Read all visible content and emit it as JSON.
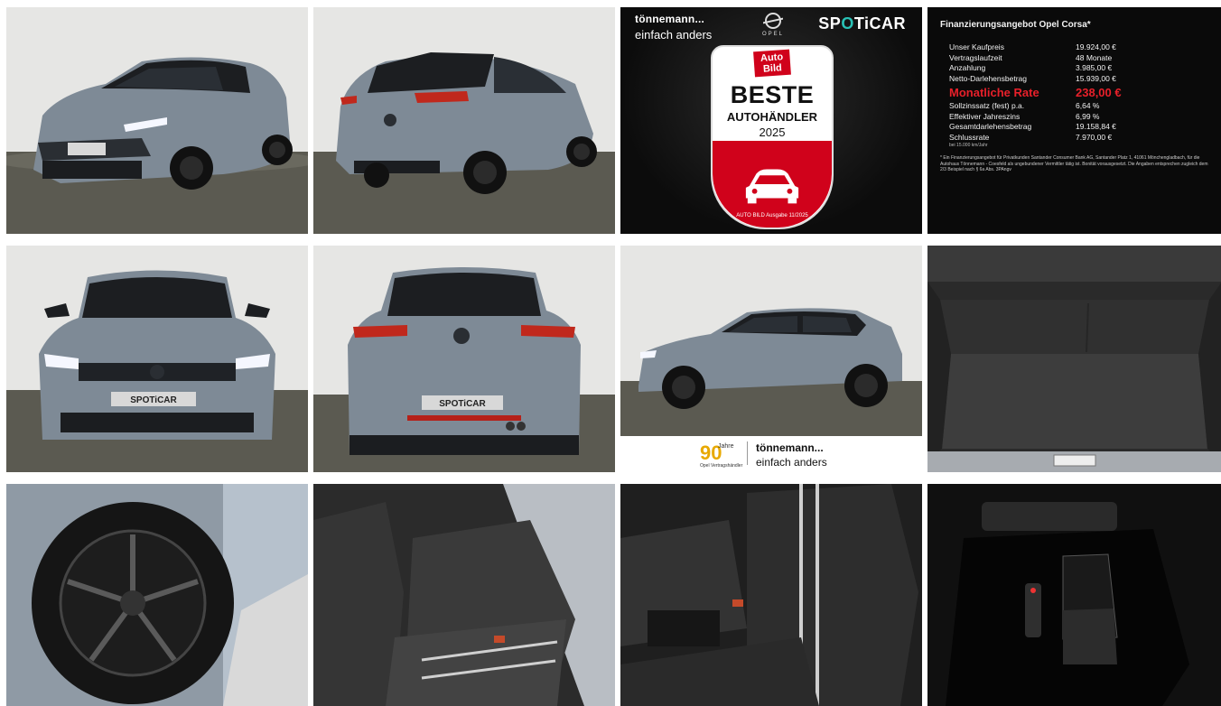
{
  "gallery": {
    "photos": [
      {
        "icon": "car-front-three-quarter-photo"
      },
      {
        "icon": "car-rear-three-quarter-photo"
      },
      {
        "icon": "dealer-award-banner"
      },
      {
        "icon": "financing-offer-panel"
      },
      {
        "icon": "car-front-photo"
      },
      {
        "icon": "car-rear-photo"
      },
      {
        "icon": "car-side-photo"
      },
      {
        "icon": "trunk-photo"
      },
      {
        "icon": "wheel-photo"
      },
      {
        "icon": "rear-seats-photo"
      },
      {
        "icon": "front-seat-photo"
      },
      {
        "icon": "center-console-photo"
      }
    ]
  },
  "dealer_banner": {
    "brand_line1": "tönnemann...",
    "brand_line2": "einfach anders",
    "opel_text": "OPEL",
    "spoticar_a": "SP",
    "spoticar_b": "O",
    "spoticar_c": "TiCAR",
    "badge_logo_line1": "Auto",
    "badge_logo_line2": "Bild",
    "badge_title": "BESTE",
    "badge_subtitle": "AUTOHÄNDLER",
    "badge_year": "2025",
    "badge_footer": "AUTO BILD Ausgabe 11/2025"
  },
  "finance": {
    "title": "Finanzierungsangebot Opel Corsa*",
    "rows": [
      {
        "label": "Unser Kaufpreis",
        "value": "19.924,00 €"
      },
      {
        "label": "Vertragslaufzeit",
        "value": "48 Monate"
      },
      {
        "label": "Anzahlung",
        "value": "3.985,00 €"
      },
      {
        "label": "Netto-Darlehensbetrag",
        "value": "15.939,00 €"
      }
    ],
    "rate_label": "Monatliche Rate",
    "rate_value": "238,00 €",
    "rows2": [
      {
        "label": "Sollzinssatz (fest) p.a.",
        "value": "6,64 %"
      },
      {
        "label": "Effektiver Jahreszins",
        "value": "6,99 %"
      },
      {
        "label": "Gesamtdarlehensbetrag",
        "value": "19.158,84 €"
      },
      {
        "label": "Schlussrate",
        "value": "7.970,00 €"
      }
    ],
    "mileage_note": "bei 15.000 km/Jahr",
    "footnote": "* Ein Finanzierungsangebot für Privatkunden Santander Consumer Bank AG, Santander Platz 1, 41061 Mönchengladbach, für die Autohaus Tönnemann - Coesfeld als ungebundener Vermittler tätig ist. Bonität vorausgesetzt. Die Angaben entsprechen zugleich dem 2/3 Beispiel nach § 6a Abs. 3PAngv"
  },
  "side_strip": {
    "ninety": "90",
    "jahre": "Jahre",
    "opel_partner": "Opel Vertragshändler",
    "brand_line1": "tönnemann...",
    "brand_line2": "einfach anders"
  },
  "plate_text": "SPOTiCAR",
  "colors": {
    "car_body": "#7e8a96",
    "car_roof": "#1c1e21",
    "studio_wall": "#e4e4e2",
    "studio_floor": "#5c5b52",
    "spoticar_teal": "#29c2b6",
    "rate_red": "#e8202a",
    "badge_red": "#d0021b"
  }
}
